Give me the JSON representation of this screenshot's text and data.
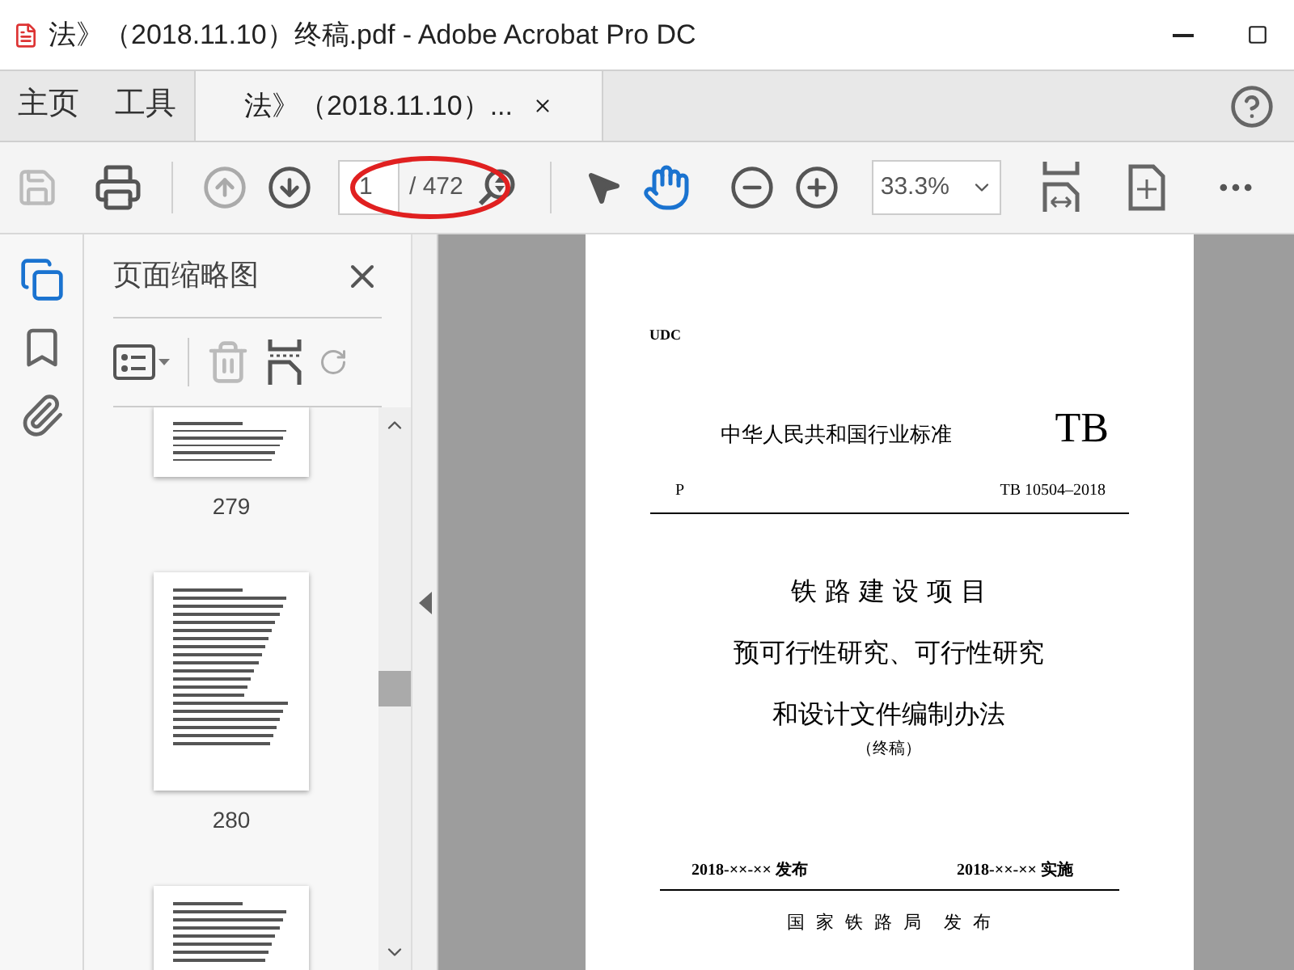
{
  "window": {
    "title": "法》（2018.11.10）终稿.pdf - Adobe Acrobat Pro DC"
  },
  "nav_tabs": [
    {
      "label": "主页",
      "selected": false
    },
    {
      "label": "工具",
      "selected": false
    },
    {
      "label": "法》（2018.11.10）...",
      "selected": true,
      "closable": true
    }
  ],
  "toolbar": {
    "page_number": "1",
    "page_total": "/ 472",
    "zoom": "33.3%",
    "hand_tool_selected": true
  },
  "annotation": {
    "ellipse_around_page_field": true
  },
  "side_rail": [
    {
      "kind": "pages",
      "selected": true
    },
    {
      "kind": "bookmarks",
      "selected": false
    },
    {
      "kind": "attachments",
      "selected": false
    }
  ],
  "thumbnails_panel": {
    "title": "页面缩略图",
    "pages": [
      {
        "label": "279"
      },
      {
        "label": "280"
      }
    ]
  },
  "document": {
    "udc": "UDC",
    "standard_title": "中华人民共和国行业标准",
    "standard_mark": "TB",
    "category": "P",
    "standard_number": "TB  10504–2018",
    "title_lines": [
      "铁 路 建 设 项 目",
      "预可行性研究、可行性研究",
      "和设计文件编制办法"
    ],
    "status": "（终稿）",
    "issued": "2018-××-××  发布",
    "effective": "2018-××-××  实施",
    "issuer": "国  家  铁  路  局    发  布"
  }
}
